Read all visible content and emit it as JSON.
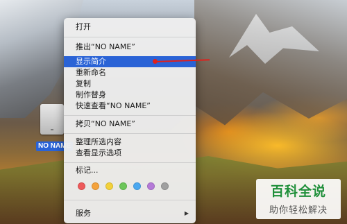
{
  "desktop": {
    "drive_label": "NO NAME"
  },
  "context_menu": {
    "items": [
      {
        "label": "打开"
      },
      {
        "label": "推出“NO NAME”"
      },
      {
        "label": "显示简介",
        "selected": true
      },
      {
        "label": "重新命名"
      },
      {
        "label": "复制"
      },
      {
        "label": "制作替身"
      },
      {
        "label": "快速查看“NO NAME”"
      },
      {
        "label": "拷贝“NO NAME”"
      },
      {
        "label": "整理所选内容"
      },
      {
        "label": "查看显示选项"
      },
      {
        "label": "标记..."
      },
      {
        "label": "服务",
        "submenu_icon": "chevron-right-icon",
        "submenu_glyph": "▶"
      }
    ],
    "tag_colors": [
      "#ee5a5a",
      "#f4a23c",
      "#f3d13a",
      "#6cc65a",
      "#4aa8f0",
      "#b57ad8",
      "#a0a0a0"
    ],
    "selected_color": "#2a63d6"
  },
  "annotation": {
    "color": "#e0201c"
  },
  "watermark": {
    "title": "百科全说",
    "subtitle": "助你轻松解决"
  }
}
